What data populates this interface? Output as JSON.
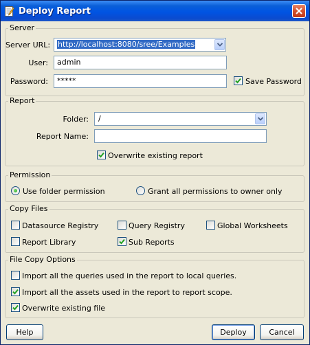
{
  "window": {
    "title": "Deploy Report"
  },
  "server": {
    "legend": "Server",
    "url_label": "Server URL:",
    "url_value": "http://localhost:8080/sree/Examples",
    "user_label": "User:",
    "user_value": "admin",
    "password_label": "Password:",
    "password_value": "*****",
    "save_password_label": "Save Password",
    "save_password_checked": true
  },
  "report": {
    "legend": "Report",
    "folder_label": "Folder:",
    "folder_value": "/",
    "name_label": "Report Name:",
    "name_value": "",
    "overwrite_label": "Overwrite existing report",
    "overwrite_checked": true
  },
  "permission": {
    "legend": "Permission",
    "options": [
      {
        "label": "Use folder permission",
        "selected": true
      },
      {
        "label": "Grant all permissions to owner only",
        "selected": false
      }
    ]
  },
  "copy_files": {
    "legend": "Copy Files",
    "items": [
      {
        "label": "Datasource Registry",
        "checked": false
      },
      {
        "label": "Query Registry",
        "checked": false
      },
      {
        "label": "Global Worksheets",
        "checked": false
      },
      {
        "label": "Report Library",
        "checked": false
      },
      {
        "label": "Sub Reports",
        "checked": true
      }
    ]
  },
  "file_copy_options": {
    "legend": "File Copy Options",
    "items": [
      {
        "label": "Import all the queries used in the report to local queries.",
        "checked": false
      },
      {
        "label": "Import all the assets used in the report to report scope.",
        "checked": true
      },
      {
        "label": "Overwrite existing file",
        "checked": true
      }
    ]
  },
  "buttons": {
    "help": "Help",
    "deploy": "Deploy",
    "cancel": "Cancel"
  },
  "icons": {
    "title": "report-edit-icon",
    "close": "close-icon",
    "dropdown": "chevron-down-icon",
    "check": "checkmark-icon"
  },
  "colors": {
    "titlebar": "#0054e3",
    "dialog_bg": "#ece9d8",
    "selection": "#316ac5",
    "check": "#21a121",
    "close_button": "#d4502d"
  }
}
